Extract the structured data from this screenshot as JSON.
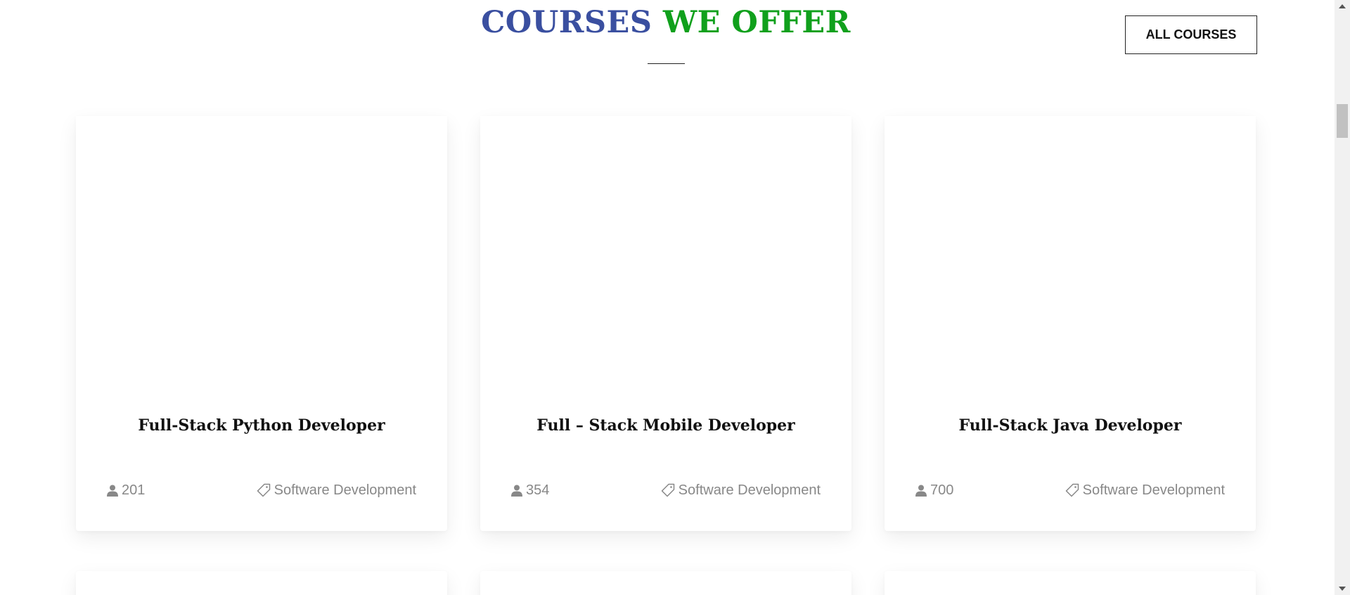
{
  "section": {
    "title_part1": "COURSES",
    "title_part2": "WE OFFER",
    "title_colors": {
      "part1": "#3a4fa0",
      "part2": "#10a01c"
    },
    "all_courses_label": "ALL COURSES"
  },
  "courses": [
    {
      "title": "Full-Stack Python Developer",
      "students": "201",
      "category": "Software Development",
      "student_icon": "user-icon",
      "category_icon": "tag-icon"
    },
    {
      "title": "Full – Stack Mobile Developer",
      "students": "354",
      "category": "Software Development",
      "student_icon": "user-icon",
      "category_icon": "tag-icon"
    },
    {
      "title": "Full-Stack Java Developer",
      "students": "700",
      "category": "Software Development",
      "student_icon": "user-icon",
      "category_icon": "tag-icon"
    }
  ]
}
